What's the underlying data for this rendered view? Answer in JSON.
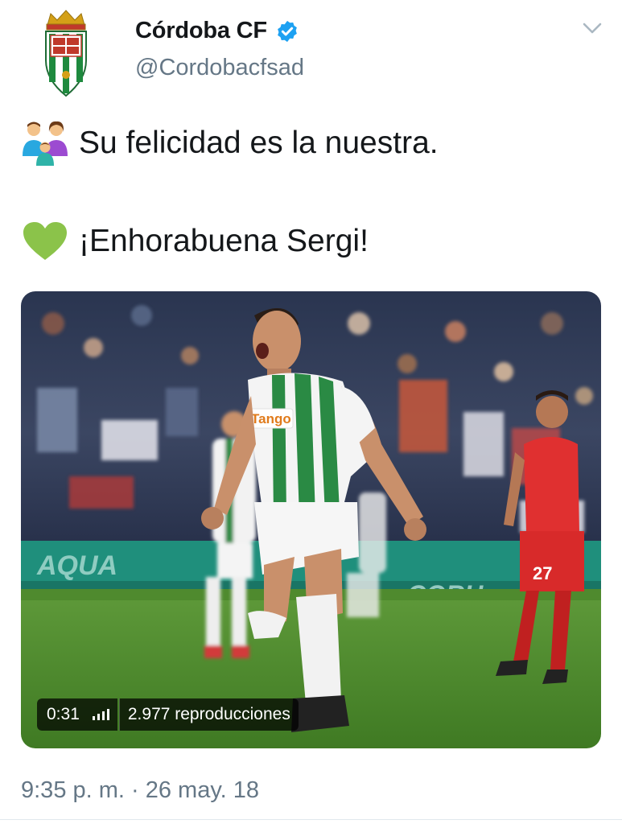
{
  "author": {
    "display_name": "Córdoba CF",
    "handle": "@Cordobacfsad",
    "verified": true
  },
  "tweet": {
    "line1": "Su felicidad es la nuestra.",
    "line1_emoji": "family-icon",
    "line2": "¡Enhorabuena Sergi!",
    "line2_emoji": "green-heart-icon"
  },
  "video": {
    "duration": "0:31",
    "views": "2.977 reproducciones",
    "shirt_sponsor": "Tango",
    "opponent_number": "27",
    "ad_board_left": "AQUA",
    "ad_board_right": "CORH"
  },
  "meta": {
    "timestamp": "9:35 p. m. · 26 may. 18"
  },
  "colors": {
    "accent": "#1da1f2",
    "secondary_text": "#657786",
    "club_green": "#1e8a3e",
    "heart": "#8bc34a"
  }
}
